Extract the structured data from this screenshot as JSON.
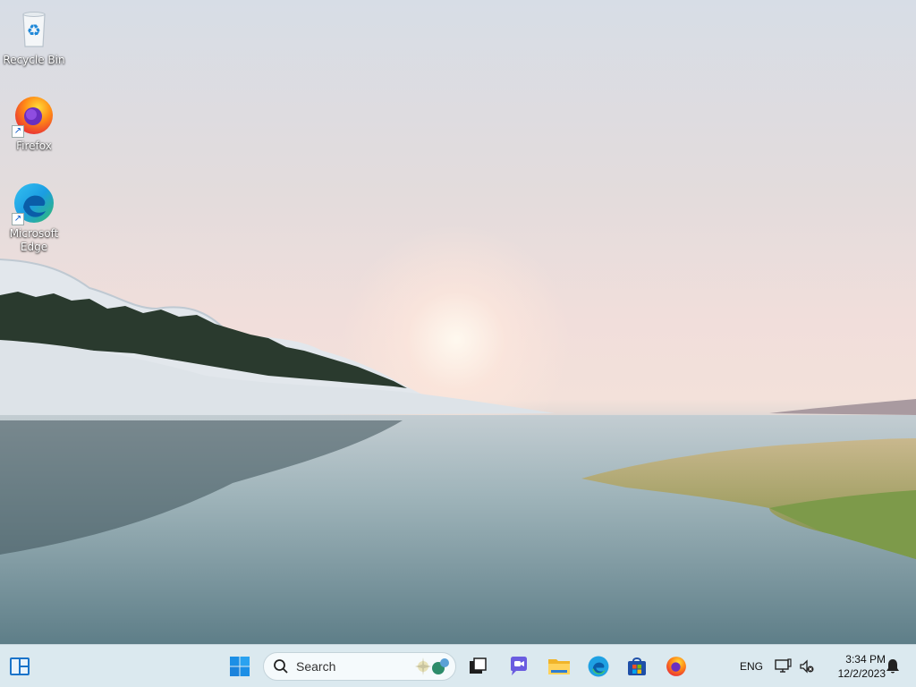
{
  "desktop": {
    "icons": [
      {
        "label": "Recycle Bin",
        "icon": "recycle-bin-icon"
      },
      {
        "label": "Firefox",
        "icon": "firefox-icon"
      },
      {
        "label": "Microsoft\nEdge",
        "icon": "edge-icon"
      }
    ]
  },
  "taskbar": {
    "search_placeholder": "Search",
    "apps": [
      "start-icon",
      "search-icon",
      "task-view-icon",
      "teams-chat-icon",
      "file-explorer-icon",
      "edge-icon",
      "microsoft-store-icon",
      "firefox-icon"
    ],
    "language": "ENG",
    "time": "3:34 PM",
    "date": "12/2/2023",
    "accent": "#0078d4",
    "background": "#dbe9ef"
  }
}
